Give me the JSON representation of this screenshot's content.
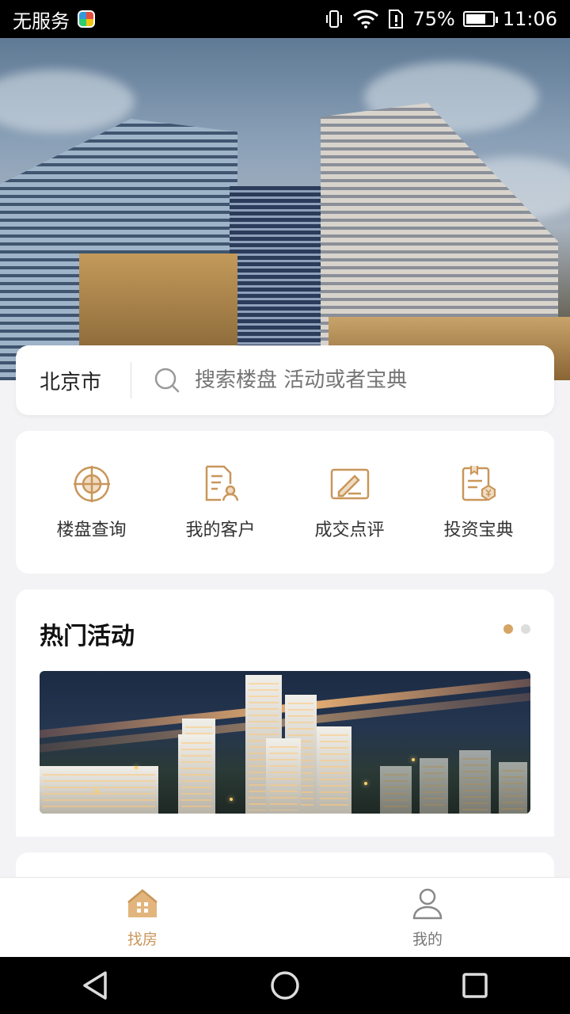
{
  "status_bar": {
    "carrier": "无服务",
    "battery": "75%",
    "battery_level": 0.75,
    "time": "11:06",
    "icons": [
      "app-badge-icon",
      "vibrate-icon",
      "wifi-icon",
      "sim-alert-icon",
      "battery-icon"
    ]
  },
  "search": {
    "city": "北京市",
    "placeholder": "搜索楼盘 活动或者宝典",
    "icon": "search-icon"
  },
  "quick_actions": [
    {
      "label": "楼盘查询",
      "icon": "target-icon"
    },
    {
      "label": "我的客户",
      "icon": "client-doc-icon"
    },
    {
      "label": "成交点评",
      "icon": "review-edit-icon"
    },
    {
      "label": "投资宝典",
      "icon": "investment-doc-icon"
    }
  ],
  "hot_activities": {
    "title": "热门活动",
    "page_count": 2,
    "active_page": 1
  },
  "tab_bar": {
    "tabs": [
      {
        "label": "找房",
        "icon": "house-icon",
        "active": true
      },
      {
        "label": "我的",
        "icon": "person-icon",
        "active": false
      }
    ]
  },
  "colors": {
    "accent": "#c9965a",
    "background": "#f3f3f5",
    "card": "#ffffff"
  }
}
